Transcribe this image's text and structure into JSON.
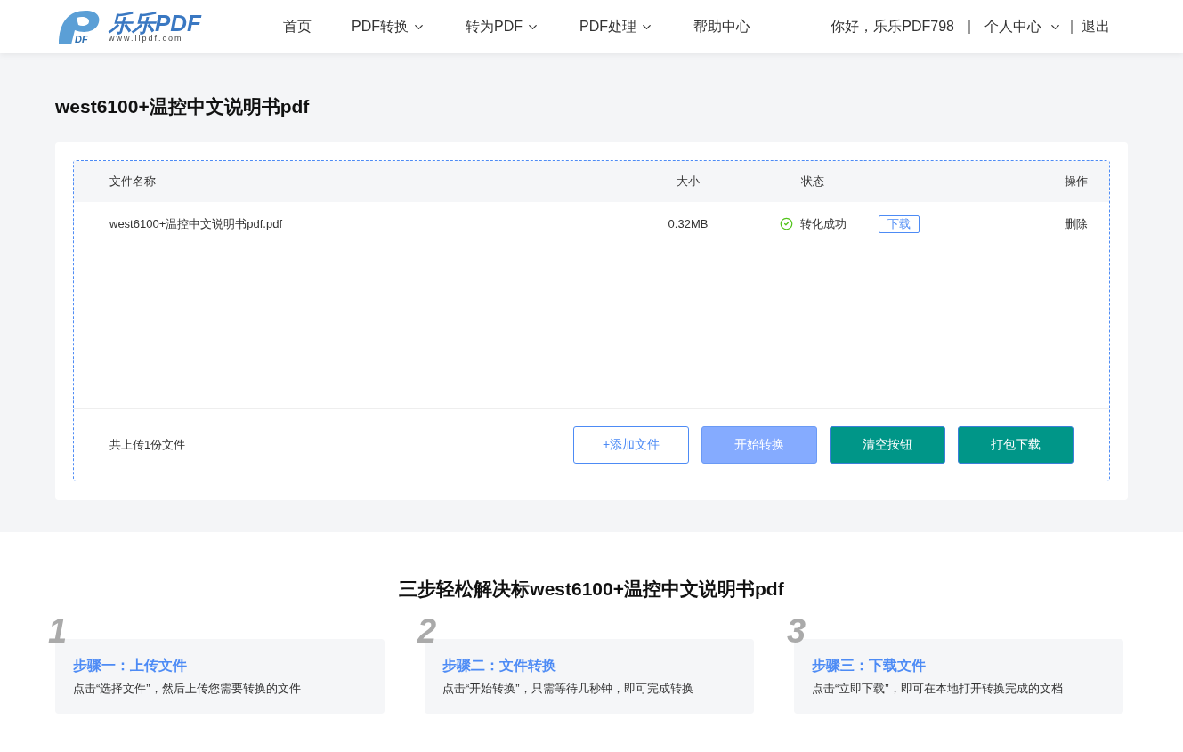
{
  "logo": {
    "mark": "DF",
    "name": "乐乐PDF",
    "url": "www.llpdf.com"
  },
  "nav": [
    {
      "label": "首页",
      "has_menu": false
    },
    {
      "label": "PDF转换",
      "has_menu": true
    },
    {
      "label": "转为PDF",
      "has_menu": true
    },
    {
      "label": "PDF处理",
      "has_menu": true
    },
    {
      "label": "帮助中心",
      "has_menu": false
    }
  ],
  "user": {
    "greeting": "你好，乐乐PDF798",
    "center": "个人中心",
    "logout": "退出"
  },
  "page_title": "west6100+温控中文说明书pdf",
  "table": {
    "columns": [
      "文件名称",
      "大小",
      "状态",
      "操作"
    ],
    "rows": [
      {
        "name": "west6100+温控中文说明书pdf.pdf",
        "size": "0.32MB",
        "status": "转化成功",
        "download": "下载",
        "delete": "删除"
      }
    ]
  },
  "upload_count": "共上传1份文件",
  "buttons": [
    {
      "label": "+添加文件",
      "kind": "outline"
    },
    {
      "label": "开始转换",
      "kind": "disabled"
    },
    {
      "label": "清空按钮",
      "kind": "solid"
    },
    {
      "label": "打包下载",
      "kind": "solid"
    }
  ],
  "steps_title": "三步轻松解决标west6100+温控中文说明书pdf",
  "steps": [
    {
      "number": "1",
      "title": "步骤一：上传文件",
      "text": "点击“选择文件”，然后上传您需要转换的文件"
    },
    {
      "number": "2",
      "title": "步骤二：文件转换",
      "text": "点击“开始转换”，只需等待几秒钟，即可完成转换"
    },
    {
      "number": "3",
      "title": "步骤三：下载文件",
      "text": "点击“立即下载”，即可在本地打开转换完成的文档"
    }
  ]
}
